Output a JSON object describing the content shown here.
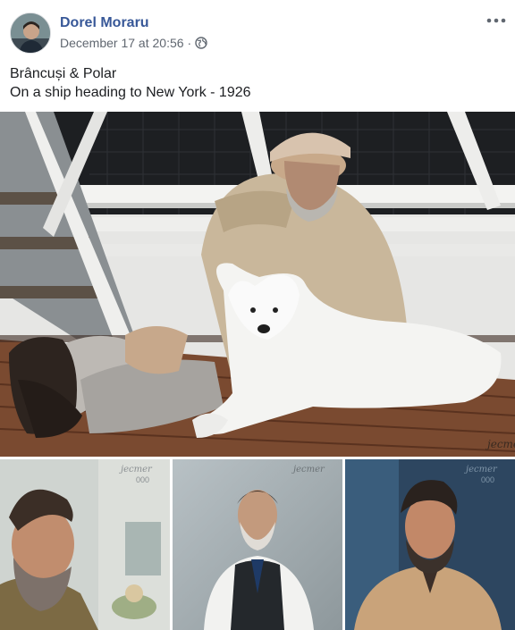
{
  "post": {
    "author": "Dorel Moraru",
    "timestamp": "December 17 at 20:56",
    "separator": "·",
    "privacy_icon": "globe-icon",
    "more_icon": "more-options-icon",
    "text_line1": "Brâncuși & Polar",
    "text_line2": "On a ship heading to New York - 1926"
  },
  "colors": {
    "author_link": "#385898",
    "meta_text": "#606770",
    "body_text": "#1c1e21"
  },
  "photos": {
    "main": "photo-brancusi-and-dog-on-ship",
    "thumbs": [
      "photo-portrait-1",
      "photo-portrait-2",
      "photo-portrait-3"
    ]
  }
}
